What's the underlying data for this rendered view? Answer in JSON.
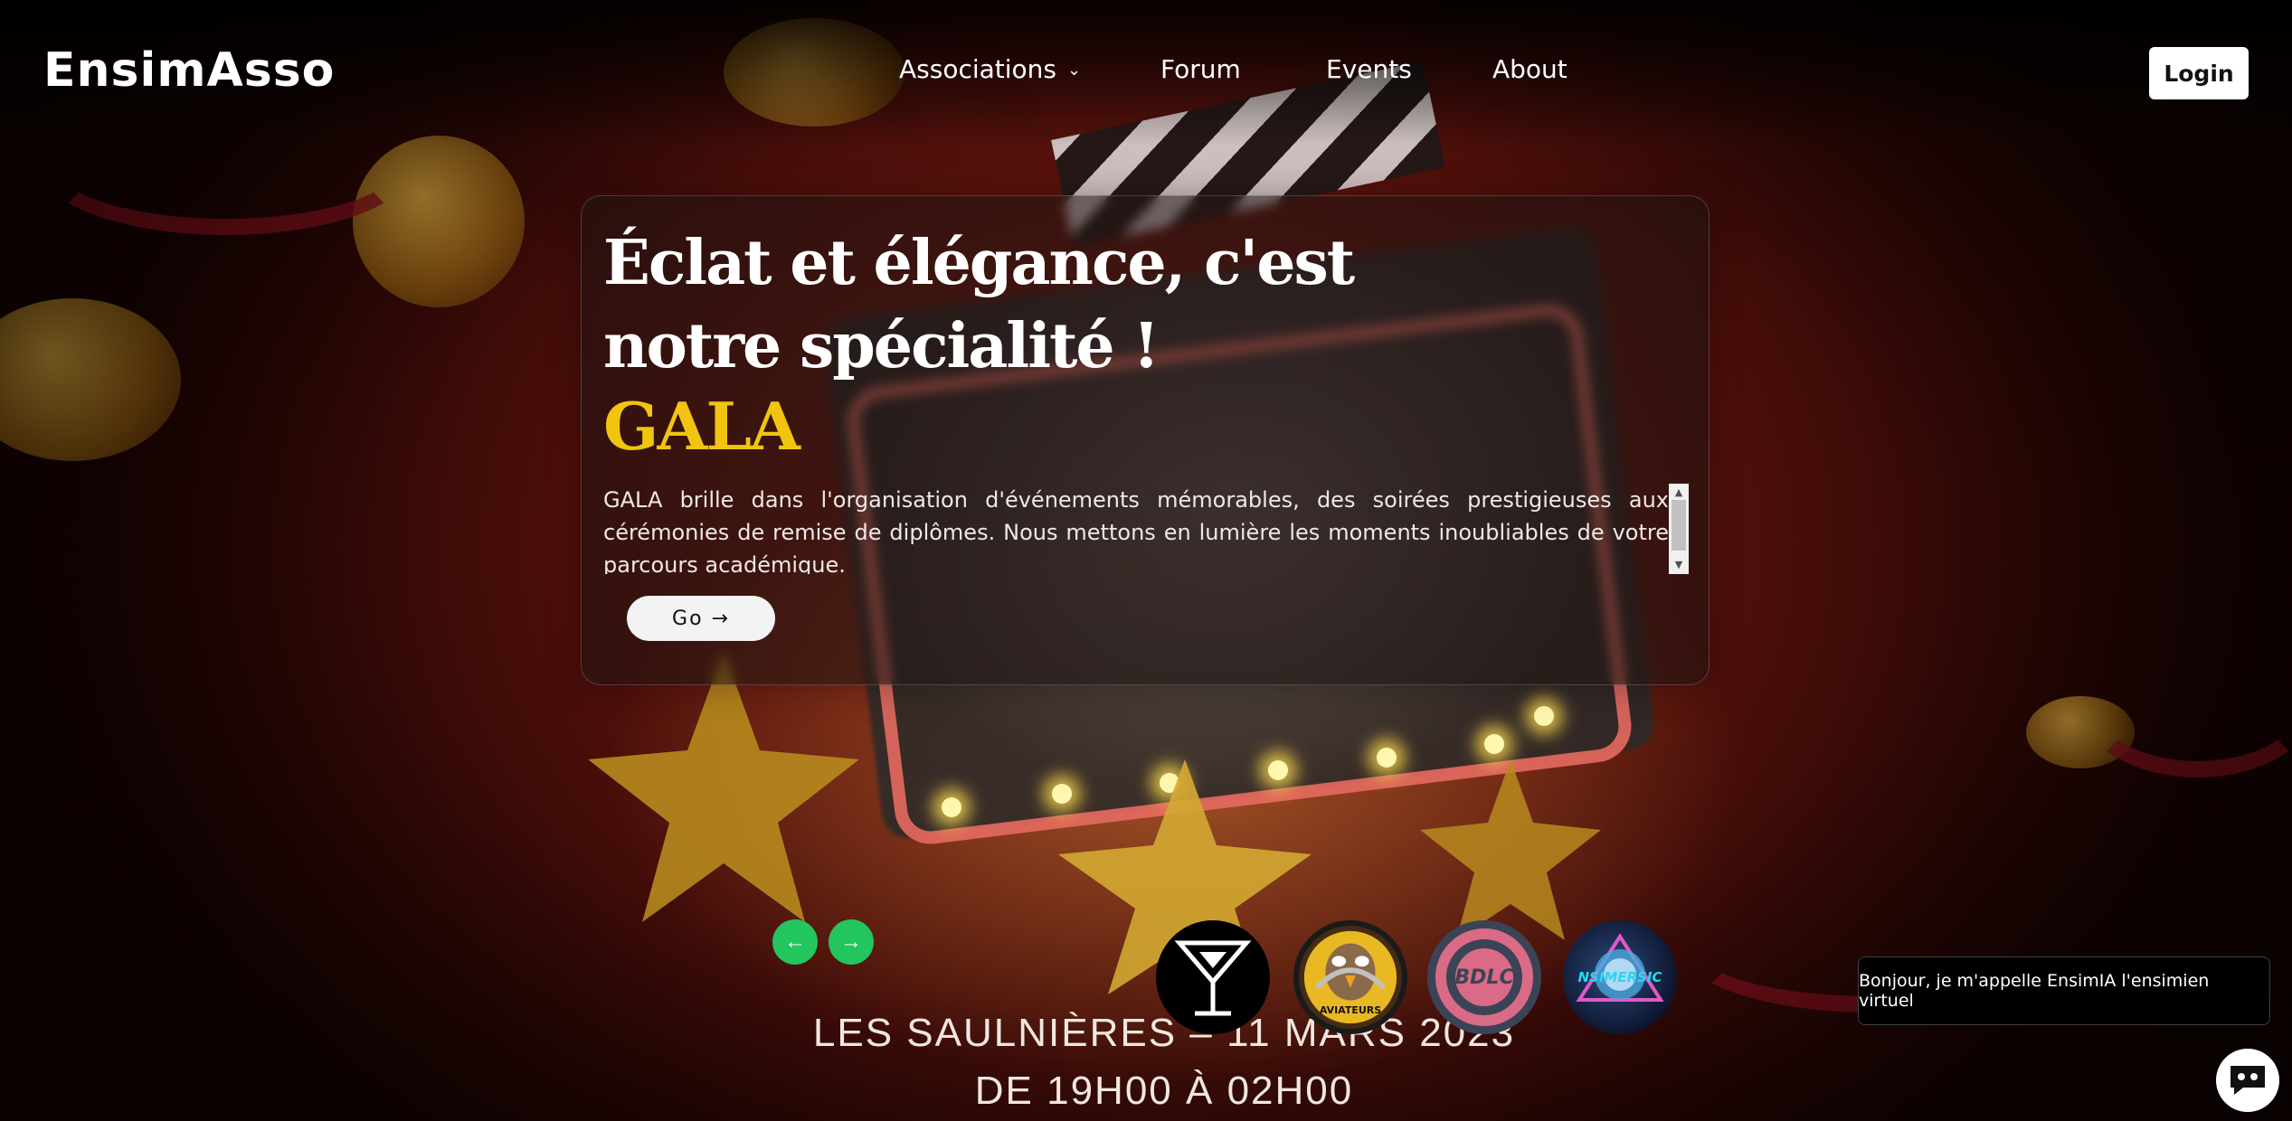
{
  "brand": {
    "logo": "EnsimAsso"
  },
  "nav": {
    "items": [
      {
        "label": "Associations",
        "has_dropdown": true
      },
      {
        "label": "Forum"
      },
      {
        "label": "Events"
      },
      {
        "label": "About"
      }
    ],
    "login_label": "Login"
  },
  "hero": {
    "title": "Éclat et élégance, c'est notre spécialité !",
    "association": "GALA",
    "description": "GALA brille dans l'organisation d'événements mémorables, des soirées prestigieuses aux cérémonies de remise de diplômes. Nous mettons en lumière les moments inoubliables de votre parcours académique.",
    "go_label": "Go →"
  },
  "background_text": {
    "line1": "LES SAULNIÈRES – 11 MARS 2023",
    "line2": "DE 19H00 À 02H00"
  },
  "carousel": {
    "prev_icon": "arrow-left-icon",
    "next_icon": "arrow-right-icon",
    "accent_color": "#22c55e"
  },
  "associations": [
    {
      "name": "cocktail-association",
      "icon": "cocktail-glass-icon"
    },
    {
      "name": "aviateurs-association",
      "label": "AVIATEURS",
      "icon": "eagle-mascot-icon"
    },
    {
      "name": "bdlc-association",
      "label": "BDLC"
    },
    {
      "name": "ensimersic-association",
      "label": "NSIMERSIC"
    }
  ],
  "chatbot": {
    "greeting": "Bonjour, je m'appelle EnsimIA l'ensimien virtuel",
    "icon": "chat-bot-icon"
  },
  "colors": {
    "title_accent": "#f1c40f",
    "button_bg": "#ffffff",
    "carousel_arrow": "#22c55e"
  }
}
